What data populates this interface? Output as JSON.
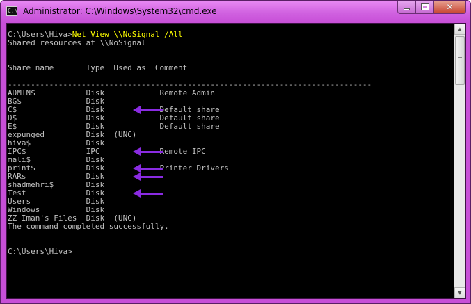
{
  "window": {
    "title": "Administrator: C:\\Windows\\System32\\cmd.exe",
    "app_icon_text": "C:\\",
    "buttons": {
      "minimize": "minimize",
      "maximize": "maximize",
      "close": "✕"
    },
    "accent_color": "#c74fd7"
  },
  "console": {
    "command_prompt": "C:\\Users\\Hiva>",
    "command": "Net View \\\\NoSignal /All",
    "shared_header": "Shared resources at \\\\NoSignal",
    "columns_header": "Share name       Type  Used as  Comment",
    "separator": "-------------------------------------------------------------------------------",
    "shares": [
      {
        "text": "ADMIN$           Disk            Remote Admin"
      },
      {
        "text": "BG$              Disk"
      },
      {
        "text": "C$               Disk            Default share"
      },
      {
        "text": "D$               Disk            Default share"
      },
      {
        "text": "E$               Disk            Default share"
      },
      {
        "text": "expunged         Disk  (UNC)"
      },
      {
        "text": "hiva$            Disk"
      },
      {
        "text": "IPC$             IPC             Remote IPC"
      },
      {
        "text": "mali$            Disk"
      },
      {
        "text": "print$           Disk            Printer Drivers"
      },
      {
        "text": "RARs             Disk"
      },
      {
        "text": "shadmehri$       Disk"
      },
      {
        "text": "Test             Disk"
      },
      {
        "text": "Users            Disk"
      },
      {
        "text": "Windows          Disk"
      },
      {
        "text": "ZZ Iman's Files  Disk  (UNC)"
      }
    ],
    "completion": "The command completed successfully.",
    "final_prompt": "C:\\Users\\Hiva>",
    "highlight_color": "#8a2be2"
  }
}
